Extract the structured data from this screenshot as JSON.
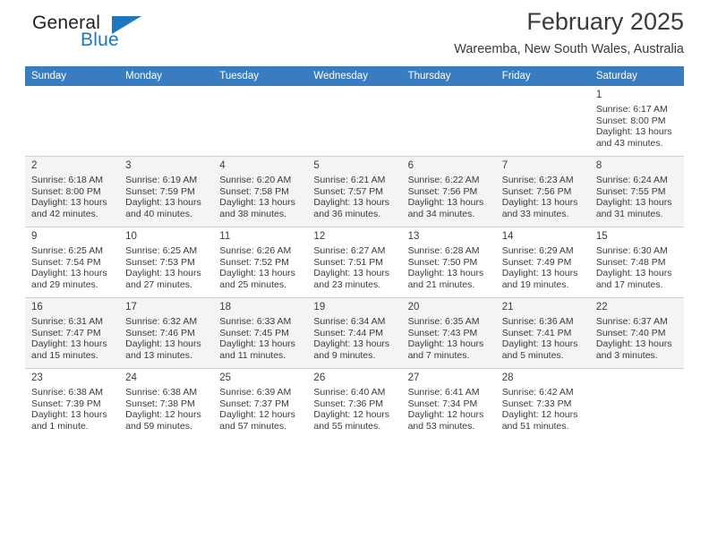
{
  "brand": {
    "name_top": "General",
    "name_bottom": "Blue",
    "triangle_color": "#1f77bc"
  },
  "header": {
    "title": "February 2025",
    "subtitle": "Wareemba, New South Wales, Australia",
    "header_bg": "#3a7cc0"
  },
  "labels": {
    "sunrise_prefix": "Sunrise:",
    "sunset_prefix": "Sunset:",
    "daylight_prefix": "Daylight:"
  },
  "weekdays": [
    "Sunday",
    "Monday",
    "Tuesday",
    "Wednesday",
    "Thursday",
    "Friday",
    "Saturday"
  ],
  "weeks": [
    [
      {
        "day": "",
        "sunrise": "",
        "sunset": "",
        "daylight": ""
      },
      {
        "day": "",
        "sunrise": "",
        "sunset": "",
        "daylight": ""
      },
      {
        "day": "",
        "sunrise": "",
        "sunset": "",
        "daylight": ""
      },
      {
        "day": "",
        "sunrise": "",
        "sunset": "",
        "daylight": ""
      },
      {
        "day": "",
        "sunrise": "",
        "sunset": "",
        "daylight": ""
      },
      {
        "day": "",
        "sunrise": "",
        "sunset": "",
        "daylight": ""
      },
      {
        "day": "1",
        "sunrise": "Sunrise: 6:17 AM",
        "sunset": "Sunset: 8:00 PM",
        "daylight": "Daylight: 13 hours and 43 minutes."
      }
    ],
    [
      {
        "day": "2",
        "sunrise": "Sunrise: 6:18 AM",
        "sunset": "Sunset: 8:00 PM",
        "daylight": "Daylight: 13 hours and 42 minutes."
      },
      {
        "day": "3",
        "sunrise": "Sunrise: 6:19 AM",
        "sunset": "Sunset: 7:59 PM",
        "daylight": "Daylight: 13 hours and 40 minutes."
      },
      {
        "day": "4",
        "sunrise": "Sunrise: 6:20 AM",
        "sunset": "Sunset: 7:58 PM",
        "daylight": "Daylight: 13 hours and 38 minutes."
      },
      {
        "day": "5",
        "sunrise": "Sunrise: 6:21 AM",
        "sunset": "Sunset: 7:57 PM",
        "daylight": "Daylight: 13 hours and 36 minutes."
      },
      {
        "day": "6",
        "sunrise": "Sunrise: 6:22 AM",
        "sunset": "Sunset: 7:56 PM",
        "daylight": "Daylight: 13 hours and 34 minutes."
      },
      {
        "day": "7",
        "sunrise": "Sunrise: 6:23 AM",
        "sunset": "Sunset: 7:56 PM",
        "daylight": "Daylight: 13 hours and 33 minutes."
      },
      {
        "day": "8",
        "sunrise": "Sunrise: 6:24 AM",
        "sunset": "Sunset: 7:55 PM",
        "daylight": "Daylight: 13 hours and 31 minutes."
      }
    ],
    [
      {
        "day": "9",
        "sunrise": "Sunrise: 6:25 AM",
        "sunset": "Sunset: 7:54 PM",
        "daylight": "Daylight: 13 hours and 29 minutes."
      },
      {
        "day": "10",
        "sunrise": "Sunrise: 6:25 AM",
        "sunset": "Sunset: 7:53 PM",
        "daylight": "Daylight: 13 hours and 27 minutes."
      },
      {
        "day": "11",
        "sunrise": "Sunrise: 6:26 AM",
        "sunset": "Sunset: 7:52 PM",
        "daylight": "Daylight: 13 hours and 25 minutes."
      },
      {
        "day": "12",
        "sunrise": "Sunrise: 6:27 AM",
        "sunset": "Sunset: 7:51 PM",
        "daylight": "Daylight: 13 hours and 23 minutes."
      },
      {
        "day": "13",
        "sunrise": "Sunrise: 6:28 AM",
        "sunset": "Sunset: 7:50 PM",
        "daylight": "Daylight: 13 hours and 21 minutes."
      },
      {
        "day": "14",
        "sunrise": "Sunrise: 6:29 AM",
        "sunset": "Sunset: 7:49 PM",
        "daylight": "Daylight: 13 hours and 19 minutes."
      },
      {
        "day": "15",
        "sunrise": "Sunrise: 6:30 AM",
        "sunset": "Sunset: 7:48 PM",
        "daylight": "Daylight: 13 hours and 17 minutes."
      }
    ],
    [
      {
        "day": "16",
        "sunrise": "Sunrise: 6:31 AM",
        "sunset": "Sunset: 7:47 PM",
        "daylight": "Daylight: 13 hours and 15 minutes."
      },
      {
        "day": "17",
        "sunrise": "Sunrise: 6:32 AM",
        "sunset": "Sunset: 7:46 PM",
        "daylight": "Daylight: 13 hours and 13 minutes."
      },
      {
        "day": "18",
        "sunrise": "Sunrise: 6:33 AM",
        "sunset": "Sunset: 7:45 PM",
        "daylight": "Daylight: 13 hours and 11 minutes."
      },
      {
        "day": "19",
        "sunrise": "Sunrise: 6:34 AM",
        "sunset": "Sunset: 7:44 PM",
        "daylight": "Daylight: 13 hours and 9 minutes."
      },
      {
        "day": "20",
        "sunrise": "Sunrise: 6:35 AM",
        "sunset": "Sunset: 7:43 PM",
        "daylight": "Daylight: 13 hours and 7 minutes."
      },
      {
        "day": "21",
        "sunrise": "Sunrise: 6:36 AM",
        "sunset": "Sunset: 7:41 PM",
        "daylight": "Daylight: 13 hours and 5 minutes."
      },
      {
        "day": "22",
        "sunrise": "Sunrise: 6:37 AM",
        "sunset": "Sunset: 7:40 PM",
        "daylight": "Daylight: 13 hours and 3 minutes."
      }
    ],
    [
      {
        "day": "23",
        "sunrise": "Sunrise: 6:38 AM",
        "sunset": "Sunset: 7:39 PM",
        "daylight": "Daylight: 13 hours and 1 minute."
      },
      {
        "day": "24",
        "sunrise": "Sunrise: 6:38 AM",
        "sunset": "Sunset: 7:38 PM",
        "daylight": "Daylight: 12 hours and 59 minutes."
      },
      {
        "day": "25",
        "sunrise": "Sunrise: 6:39 AM",
        "sunset": "Sunset: 7:37 PM",
        "daylight": "Daylight: 12 hours and 57 minutes."
      },
      {
        "day": "26",
        "sunrise": "Sunrise: 6:40 AM",
        "sunset": "Sunset: 7:36 PM",
        "daylight": "Daylight: 12 hours and 55 minutes."
      },
      {
        "day": "27",
        "sunrise": "Sunrise: 6:41 AM",
        "sunset": "Sunset: 7:34 PM",
        "daylight": "Daylight: 12 hours and 53 minutes."
      },
      {
        "day": "28",
        "sunrise": "Sunrise: 6:42 AM",
        "sunset": "Sunset: 7:33 PM",
        "daylight": "Daylight: 12 hours and 51 minutes."
      },
      {
        "day": "",
        "sunrise": "",
        "sunset": "",
        "daylight": ""
      }
    ]
  ]
}
